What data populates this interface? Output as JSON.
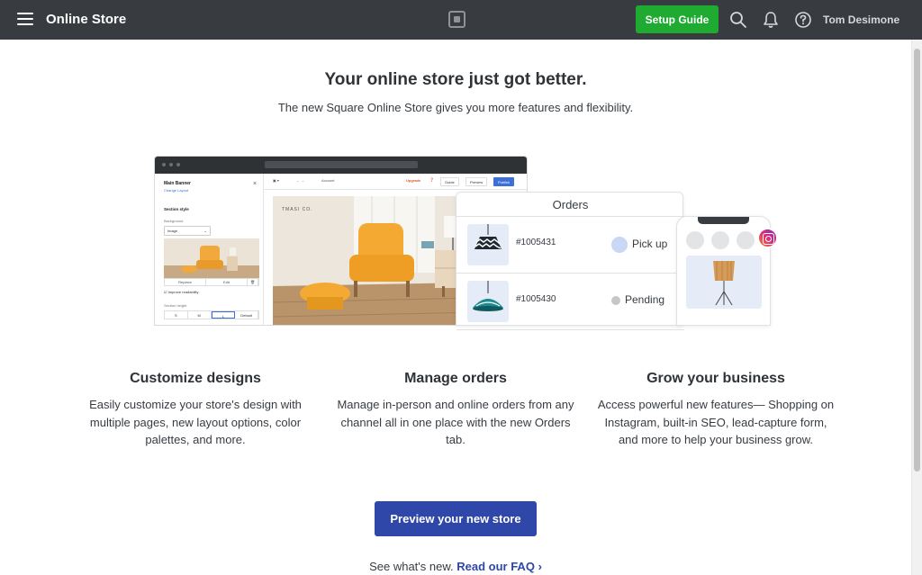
{
  "topbar": {
    "menu_icon": "hamburger-menu-icon",
    "title": "Online Store",
    "logo_icon": "square-logo-icon",
    "setup_label": "Setup Guide",
    "search_icon": "search-icon",
    "notifications_icon": "bell-icon",
    "help_icon": "help-icon",
    "user_name": "Tom Desimone"
  },
  "hero": {
    "headline": "Your online store just got better.",
    "subhead": "The new Square Online Store gives you more features and flexibility."
  },
  "illustration": {
    "panel_title": "Main Banner",
    "panel_link": "Change Layout",
    "section_style": "Section style",
    "background_label": "Background",
    "background_value": "Image",
    "replace": "Replace",
    "edit": "Edit",
    "improve_label": "Improve readability",
    "height_label": "Section height",
    "sizes": [
      "S",
      "M",
      "L",
      "Default"
    ],
    "selected_size": "L",
    "toolbar": {
      "page": "Account",
      "upgrade": "Upgrade",
      "guide": "Guide",
      "preview": "Preview",
      "publish": "Publish"
    },
    "canvas_brand": "TMASI CO.",
    "orders_title": "Orders",
    "orders": [
      {
        "number": "#1005431",
        "status": "Pick up",
        "dot_color": "#c8d7f7"
      },
      {
        "number": "#1005430",
        "status": "Pending",
        "dot_color": "#c4c6c8"
      }
    ]
  },
  "features": [
    {
      "title": "Customize designs",
      "text": "Easily customize your store's design with multiple pages, new layout options, color palettes, and more."
    },
    {
      "title": "Manage orders",
      "text": "Manage in-person and online orders from any channel all in one place with the new Orders tab."
    },
    {
      "title": "Grow your business",
      "text": "Access powerful new features— Shopping on Instagram, built-in SEO, lead-capture form, and more to help your business grow."
    }
  ],
  "cta": {
    "label": "Preview your new store"
  },
  "faq": {
    "prefix": "See what's new.",
    "link": "Read our FAQ",
    "chevron": "›"
  },
  "colors": {
    "topbar": "#383c40",
    "setup_green": "#1faa32",
    "primary_blue": "#2f47a8"
  }
}
